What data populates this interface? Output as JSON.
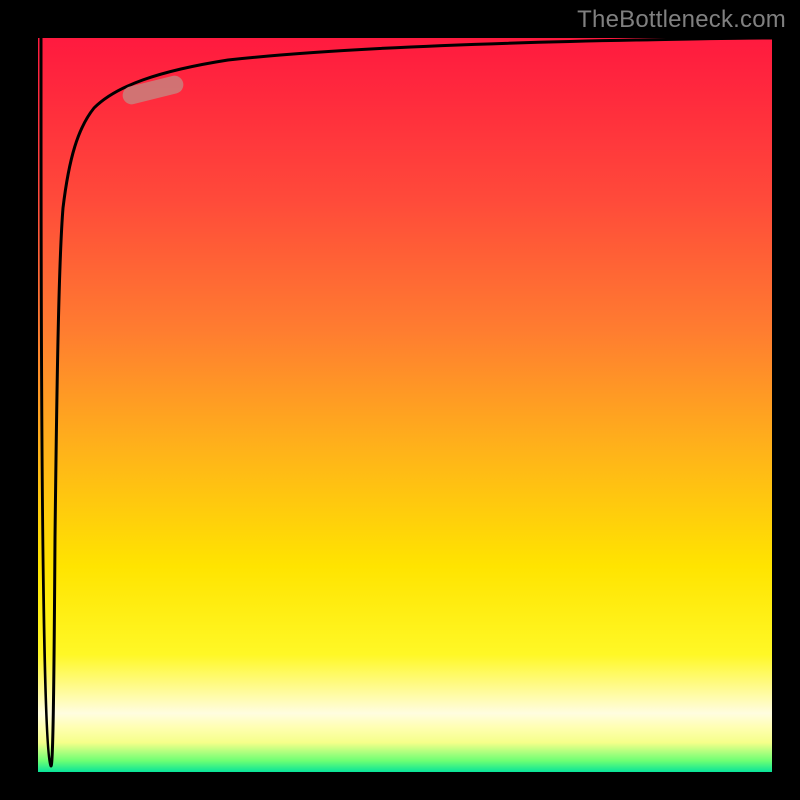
{
  "watermark": {
    "text": "TheBottleneck.com"
  },
  "chart_data": {
    "type": "line",
    "title": "",
    "xlabel": "",
    "ylabel": "",
    "x_range": [
      0,
      100
    ],
    "y_range": [
      0,
      100
    ],
    "background_gradient": [
      {
        "pos": 0.0,
        "color": "#ff1a3f"
      },
      {
        "pos": 0.4,
        "color": "#ff7d30"
      },
      {
        "pos": 0.72,
        "color": "#ffe400"
      },
      {
        "pos": 0.93,
        "color": "#fffde0"
      },
      {
        "pos": 0.985,
        "color": "#6cff74"
      },
      {
        "pos": 1.0,
        "color": "#08e39a"
      }
    ],
    "series": [
      {
        "name": "curve",
        "color": "#000000",
        "x": [
          3.0,
          3.2,
          3.5,
          4.0,
          4.5,
          5.0,
          6.0,
          8.0,
          10.0,
          13.0,
          17.0,
          22.0,
          30.0,
          40.0,
          55.0,
          70.0,
          85.0,
          100.0
        ],
        "y": [
          0.0,
          40.0,
          65.0,
          78.0,
          83.0,
          85.5,
          88.0,
          90.5,
          91.7,
          92.8,
          93.6,
          94.3,
          95.2,
          96.0,
          96.8,
          97.4,
          97.9,
          98.4
        ]
      }
    ],
    "highlight": {
      "name": "pill-marker",
      "x_center": 15.0,
      "y_center": 93.2,
      "color": "#c9807c"
    }
  }
}
